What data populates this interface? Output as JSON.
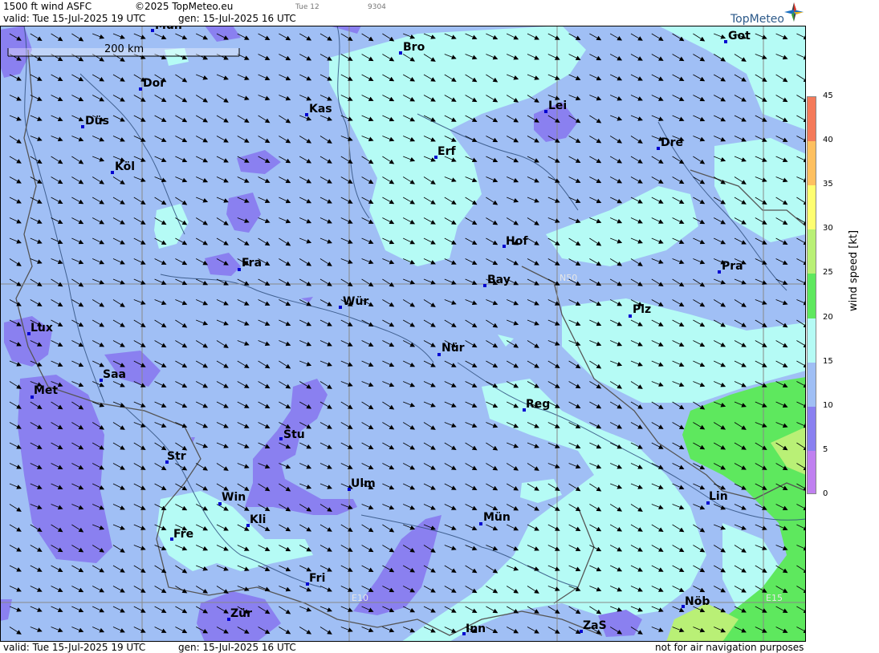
{
  "header": {
    "product": "1500 ft wind ASFC",
    "copyright": "©2025 TopMeteo.eu",
    "issue_tag": "Tue 12",
    "code": "9304",
    "valid": "valid:  Tue  15-Jul-2025  19 UTC",
    "generated": "gen: 15-Jul-2025 16 UTC"
  },
  "brand": {
    "name": "TopMeteo"
  },
  "footer": {
    "valid": "valid:  Tue  15-Jul-2025  19 UTC",
    "generated": "gen: 15-Jul-2025 16 UTC",
    "disclaimer": "not for air navigation purposes"
  },
  "scale_bar": {
    "label": "200 km"
  },
  "grid_labels": {
    "lat": "N50",
    "lon1": "E10",
    "lon2": "E15"
  },
  "cities": [
    {
      "name": "Mün",
      "id": "mun-north"
    },
    {
      "name": "Bro"
    },
    {
      "name": "Got"
    },
    {
      "name": "Dor"
    },
    {
      "name": "Kas"
    },
    {
      "name": "Lei"
    },
    {
      "name": "Düs"
    },
    {
      "name": "Erf"
    },
    {
      "name": "Dre"
    },
    {
      "name": "Köl"
    },
    {
      "name": "Hof"
    },
    {
      "name": "Fra"
    },
    {
      "name": "Pra"
    },
    {
      "name": "Bay"
    },
    {
      "name": "Wür"
    },
    {
      "name": "Plz"
    },
    {
      "name": "Lux"
    },
    {
      "name": "Nür"
    },
    {
      "name": "Saa"
    },
    {
      "name": "Met"
    },
    {
      "name": "Reg"
    },
    {
      "name": "Stu"
    },
    {
      "name": "Str"
    },
    {
      "name": "Ulm"
    },
    {
      "name": "Win"
    },
    {
      "name": "Lin"
    },
    {
      "name": "Kli"
    },
    {
      "name": "Mün"
    },
    {
      "name": "Fre"
    },
    {
      "name": "Fri"
    },
    {
      "name": "Nöb"
    },
    {
      "name": "Zür"
    },
    {
      "name": "Inn"
    },
    {
      "name": "ZaS"
    }
  ],
  "legend": {
    "title": "wind speed [kt]",
    "ticks": [
      "0",
      "5",
      "10",
      "15",
      "20",
      "25",
      "30",
      "35",
      "40",
      "45"
    ],
    "colors": [
      "#c080f0",
      "#8a80f0",
      "#a0bff5",
      "#b5fbf5",
      "#5ee85e",
      "#b9f076",
      "#fefe70",
      "#fec060",
      "#f47a5a"
    ]
  },
  "wind": {
    "direction": "northwest",
    "typical_speed_kt": 10
  },
  "colors": {
    "base_blue": "#a0bff5",
    "cyan": "#b5fbf5",
    "purple": "#8a80f0",
    "green": "#5ee85e",
    "light_green": "#b9f076",
    "marker": "#0000d0"
  }
}
